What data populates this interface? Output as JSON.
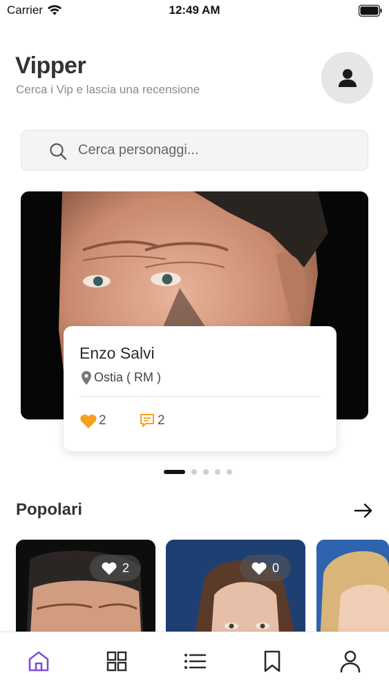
{
  "status_bar": {
    "carrier": "Carrier",
    "time": "12:49 AM"
  },
  "header": {
    "title": "Vipper",
    "subtitle": "Cerca i Vip e lascia una recensione"
  },
  "search": {
    "placeholder": "Cerca personaggi..."
  },
  "featured": {
    "name": "Enzo Salvi",
    "location": "Ostia ( RM )",
    "likes": "2",
    "comments": "2",
    "pager": {
      "count": 5,
      "active_index": 0
    }
  },
  "popular": {
    "title": "Popolari",
    "cards": [
      {
        "likes": "2"
      },
      {
        "likes": "0"
      },
      {
        "likes": ""
      }
    ]
  },
  "colors": {
    "accent": "#f7a11a",
    "tab_active": "#7b4fd6",
    "tab_inactive": "#2a2a2a"
  },
  "tabbar": {
    "items": [
      {
        "icon": "home-icon",
        "active": true
      },
      {
        "icon": "grid-icon",
        "active": false
      },
      {
        "icon": "list-icon",
        "active": false
      },
      {
        "icon": "bookmark-icon",
        "active": false
      },
      {
        "icon": "user-icon",
        "active": false
      }
    ]
  }
}
